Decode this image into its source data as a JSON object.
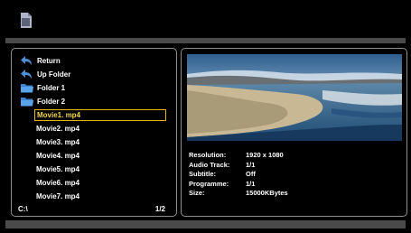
{
  "browser": {
    "items": [
      {
        "type": "back",
        "label": "Return",
        "icon": "return-arrow-icon"
      },
      {
        "type": "back",
        "label": "Up Folder",
        "icon": "return-arrow-icon"
      },
      {
        "type": "folder",
        "label": "Folder 1",
        "icon": "folder-icon"
      },
      {
        "type": "folder",
        "label": "Folder 2",
        "icon": "folder-icon"
      },
      {
        "type": "file",
        "label": "Movie1. mp4",
        "selected": true
      },
      {
        "type": "file",
        "label": "Movie2. mp4"
      },
      {
        "type": "file",
        "label": "Movie3. mp4"
      },
      {
        "type": "file",
        "label": "Movie4. mp4"
      },
      {
        "type": "file",
        "label": "Movie5. mp4"
      },
      {
        "type": "file",
        "label": "Movie6. mp4"
      },
      {
        "type": "file",
        "label": "Movie7. mp4"
      }
    ],
    "path": "C:\\",
    "page": "1/2"
  },
  "details": {
    "rows": [
      {
        "key": "Resolution:",
        "value": "1920 x 1080"
      },
      {
        "key": "Audio Track:",
        "value": "1/1"
      },
      {
        "key": "Subtitle:",
        "value": "Off"
      },
      {
        "key": "Programme:",
        "value": "1/1"
      },
      {
        "key": "Size:",
        "value": "15000KBytes"
      }
    ]
  },
  "colors": {
    "selection_border": "#e6b800",
    "bar_gray": "#4a4a4a",
    "panel_border": "#8f8f8f"
  }
}
